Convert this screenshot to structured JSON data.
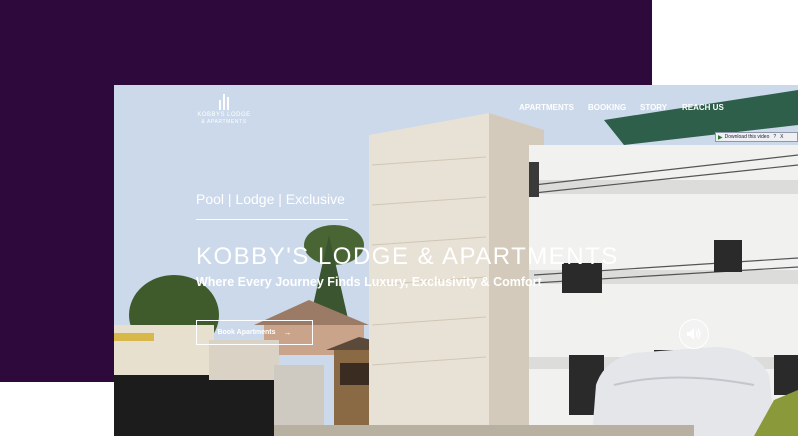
{
  "brand": {
    "line1": "KOBBYS LODGE",
    "line2": "& APARTMENTS"
  },
  "nav": {
    "items": [
      "APARTMENTS",
      "BOOKING",
      "STORY",
      "REACH US"
    ]
  },
  "download_bar": {
    "label": "Download this video",
    "help": "?",
    "close": "X"
  },
  "hero": {
    "tagline": "Pool | Lodge | Exclusive",
    "title": "KOBBY'S LODGE & APARTMENTS",
    "subtitle": "Where Every Journey Finds Luxury, Exclusivity & Comfort",
    "cta_label": "Book Apartments",
    "cta_arrow": "→"
  },
  "icons": {
    "logo": "building-logo-icon",
    "sound": "speaker-volume-icon",
    "download": "play-icon"
  },
  "colors": {
    "background_block": "#2e0a3c",
    "text": "#ffffff"
  }
}
